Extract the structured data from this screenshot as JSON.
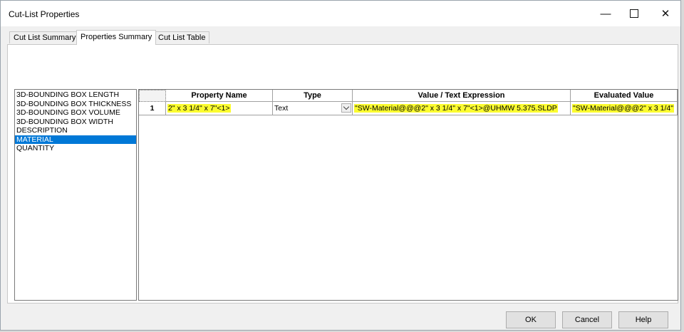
{
  "window": {
    "title": "Cut-List Properties",
    "controls": {
      "minimize": "—",
      "close": "✕"
    }
  },
  "tabs": [
    {
      "label": "Cut List Summary",
      "active": false
    },
    {
      "label": "Properties Summary",
      "active": true
    },
    {
      "label": "Cut List Table",
      "active": false
    }
  ],
  "property_list": {
    "items": [
      "3D-BOUNDING BOX LENGTH",
      "3D-BOUNDING BOX THICKNESS",
      "3D-BOUNDING BOX VOLUME",
      "3D-BOUNDING BOX WIDTH",
      "DESCRIPTION",
      "MATERIAL",
      "QUANTITY"
    ],
    "selected": "MATERIAL"
  },
  "grid": {
    "columns": [
      "Property Name",
      "Type",
      "Value / Text Expression",
      "Evaluated Value"
    ],
    "rows": [
      {
        "index": "1",
        "property_name": "2\" x 3 1/4\" x 7\"<1>",
        "type": "Text",
        "value_expression": "\"SW-Material@@@2\" x 3 1/4\" x 7\"<1>@UHMW 5.375.SLDP",
        "evaluated_value": "\"SW-Material@@@2\" x 3 1/4\""
      }
    ]
  },
  "buttons": {
    "ok": "OK",
    "cancel": "Cancel",
    "help": "Help"
  },
  "colors": {
    "selection": "#0078d7",
    "highlight": "#fbfc2f"
  }
}
